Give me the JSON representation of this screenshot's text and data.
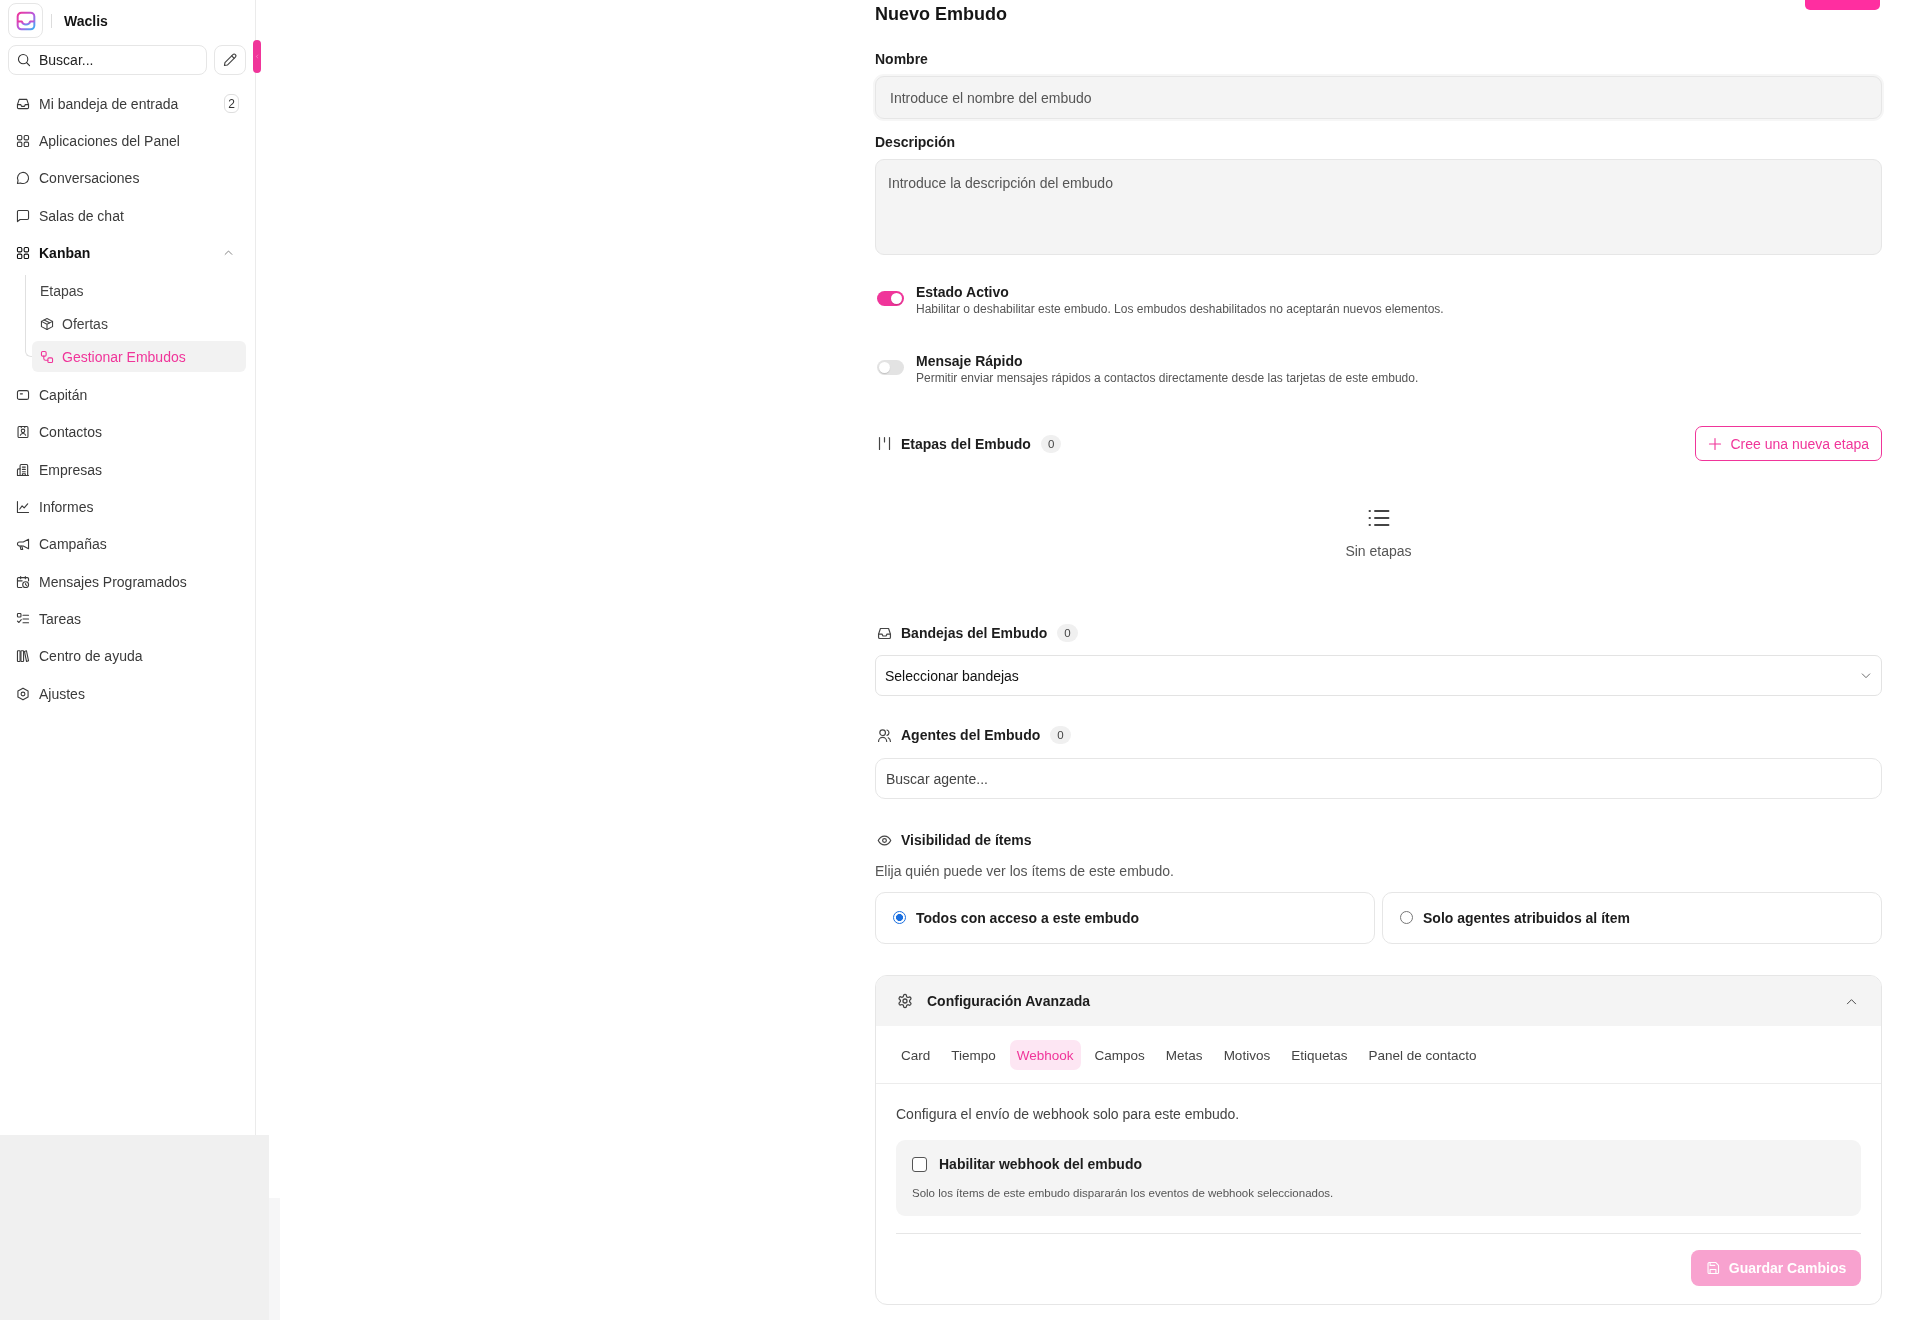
{
  "sidebar": {
    "brand": "Waclis",
    "search": {
      "placeholder": "Buscar..."
    },
    "items": [
      {
        "label": "Mi bandeja de entrada",
        "badge": "2",
        "selected": false
      },
      {
        "label": "Aplicaciones del Panel",
        "selected": false
      },
      {
        "label": "Conversaciones",
        "selected": false
      },
      {
        "label": "Salas de chat",
        "selected": false
      },
      {
        "label": "Kanban",
        "selected": false,
        "expanded": true,
        "children": [
          {
            "label": "Etapas",
            "selected": false
          },
          {
            "label": "Ofertas",
            "selected": false
          },
          {
            "label": "Gestionar Embudos",
            "selected": true
          }
        ]
      },
      {
        "label": "Capitán",
        "selected": false
      },
      {
        "label": "Contactos",
        "selected": false
      },
      {
        "label": "Empresas",
        "selected": false
      },
      {
        "label": "Informes",
        "selected": false
      },
      {
        "label": "Campañas",
        "selected": false
      },
      {
        "label": "Mensajes Programados",
        "selected": false
      },
      {
        "label": "Tareas",
        "selected": false
      },
      {
        "label": "Centro de ayuda",
        "selected": false
      },
      {
        "label": "Ajustes",
        "selected": false
      }
    ]
  },
  "header": {
    "title": "Nuevo Embudo"
  },
  "form": {
    "fields": [
      {
        "kind": "input",
        "label": "Nombre",
        "placeholder": "Introduce el nombre del embudo"
      },
      {
        "kind": "textarea",
        "label": "Descripción",
        "placeholder": "Introduce la descripción del embudo"
      }
    ],
    "toggles": [
      {
        "label": "Estado Activo",
        "description": "Habilitar o deshabilitar este embudo. Los embudos deshabilitados no aceptarán nuevos elementos.",
        "on": true
      },
      {
        "label": "Mensaje Rápido",
        "description": "Permitir enviar mensajes rápidos a contactos directamente desde las tarjetas de este embudo.",
        "on": false
      }
    ]
  },
  "stages": {
    "title": "Etapas del Embudo",
    "count": "0",
    "button": "Cree una nueva etapa",
    "empty_text": "Sin etapas"
  },
  "inboxes": {
    "title": "Bandejas del Embudo",
    "count": "0",
    "value": "Seleccionar bandejas"
  },
  "agents": {
    "title": "Agentes del Embudo",
    "count": "0",
    "placeholder": "Buscar agente..."
  },
  "visibility": {
    "title": "Visibilidad de ítems",
    "description": "Elija quién puede ver los ítems de este embudo.",
    "options": [
      {
        "label": "Todos con acceso a este embudo",
        "selected": true
      },
      {
        "label": "Solo agentes atribuidos al ítem",
        "selected": false
      }
    ]
  },
  "advanced": {
    "title": "Configuración Avanzada",
    "expanded": true,
    "tabs": [
      {
        "label": "Card",
        "selected": false
      },
      {
        "label": "Tiempo",
        "selected": false
      },
      {
        "label": "Webhook",
        "selected": true
      },
      {
        "label": "Campos",
        "selected": false
      },
      {
        "label": "Metas",
        "selected": false
      },
      {
        "label": "Motivos",
        "selected": false
      },
      {
        "label": "Etiquetas",
        "selected": false
      },
      {
        "label": "Panel de contacto",
        "selected": false
      }
    ],
    "description": "Configura el envío de webhook solo para este embudo.",
    "checkbox": {
      "label": "Habilitar webhook del embudo",
      "checked": false,
      "hint": "Solo los ítems de este embudo dispararán los eventos de webhook seleccionados."
    },
    "save_button": {
      "label": "Guardar Cambios",
      "disabled": true
    }
  }
}
